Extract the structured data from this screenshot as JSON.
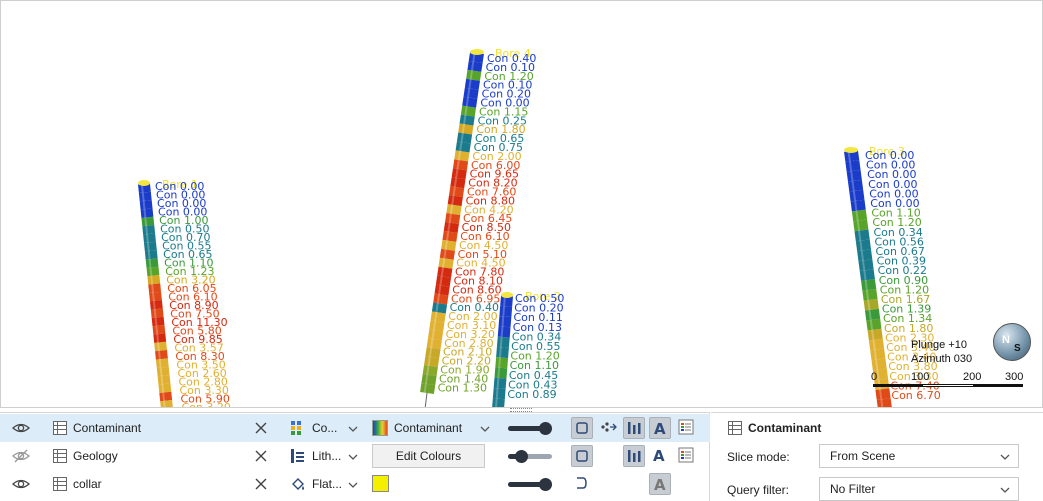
{
  "scene": {
    "holes": [
      {
        "name": "Bore 1",
        "labels": [
          "Con 0.00",
          "Con 0.00",
          "Con 0.00",
          "Con 0.00",
          "Con 1.00",
          "Con 0.50",
          "Con 0.70",
          "Con 0.55",
          "Con 0.65",
          "Con 1.10",
          "Con 1.23",
          "Con 3.20",
          "Con 6.05",
          "Con 6.10",
          "Con 8.90",
          "Con 7.50",
          "Con 11.30",
          "Con 5.80",
          "Con 9.85",
          "Con 3.57",
          "Con 8.30",
          "Con 3.50",
          "Con 2.60",
          "Con 2.80",
          "Con 3.30",
          "Con 5.90",
          "Con 3.20"
        ],
        "colors": [
          "#1a3cc9",
          "#1a3cc9",
          "#1a3cc9",
          "#1a3cc9",
          "#3a9a3a",
          "#1b7a8c",
          "#1b7a8c",
          "#1b7a8c",
          "#1b7a8c",
          "#3a9a3a",
          "#58a42a",
          "#d8a820",
          "#e04a18",
          "#e04a18",
          "#d42a10",
          "#e04a18",
          "#d42a10",
          "#e04a18",
          "#d42a10",
          "#e0b030",
          "#e04a18",
          "#e0b030",
          "#e0b030",
          "#e0b030",
          "#e0b030",
          "#e04a18",
          "#e0b030"
        ]
      },
      {
        "name": "Bore 4",
        "labels": [
          "Con 0.40",
          "Con 0.10",
          "Con 1.20",
          "Con 0.10",
          "Con 0.20",
          "Con 0.00",
          "Con 1.15",
          "Con 0.25",
          "Con 1.80",
          "Con 0.65",
          "Con 0.75",
          "Con 2.00",
          "Con 6.00",
          "Con 9.65",
          "Con 8.20",
          "Con 7.60",
          "Con 8.80",
          "Con 4.20",
          "Con 6.45",
          "Con 8.50",
          "Con 6.10",
          "Con 4.50",
          "Con 5.10",
          "Con 4.50",
          "Con 7.80",
          "Con 8.10",
          "Con 8.60",
          "Con 6.95",
          "Con 0.40",
          "Con 2.00",
          "Con 3.10",
          "Con 3.20",
          "Con 2.80",
          "Con 2.10",
          "Con 2.20",
          "Con 1.90",
          "Con 1.40",
          "Con 1.30"
        ],
        "colors": [
          "#1a3cc9",
          "#1a3cc9",
          "#58a42a",
          "#1a3cc9",
          "#1a3cc9",
          "#1a3cc9",
          "#58a42a",
          "#1b7a8c",
          "#d8a820",
          "#1b7a8c",
          "#1b7a8c",
          "#e0b030",
          "#e04a18",
          "#d42a10",
          "#d42a10",
          "#e04a18",
          "#d42a10",
          "#e0b030",
          "#e04a18",
          "#d42a10",
          "#e04a18",
          "#e0b030",
          "#e04a18",
          "#e0b030",
          "#d42a10",
          "#d42a10",
          "#d42a10",
          "#e04a18",
          "#1b7a8c",
          "#e0b030",
          "#e0b030",
          "#e0b030",
          "#e0b030",
          "#c8a828",
          "#c8a828",
          "#8aa82a",
          "#6ea22a",
          "#6ea22a"
        ]
      },
      {
        "name": "Bore 2",
        "labels": [
          "Con 0.50",
          "Con 0.20",
          "Con 0.11",
          "Con 0.13",
          "Con 0.34",
          "Con 0.55",
          "Con 1.20",
          "Con 1.10",
          "Con 0.45",
          "Con 0.43",
          "Con 0.89"
        ],
        "colors": [
          "#1a3cc9",
          "#1a3cc9",
          "#1a3cc9",
          "#1a3cc9",
          "#1b7a8c",
          "#1b7a8c",
          "#58a42a",
          "#3a9a3a",
          "#1b7a8c",
          "#1b7a8c",
          "#1b7a8c"
        ]
      },
      {
        "name": "Bore 3",
        "labels": [
          "Con 0.00",
          "Con 0.00",
          "Con 0.00",
          "Con 0.00",
          "Con 0.00",
          "Con 0.00",
          "Con 1.10",
          "Con 1.20",
          "Con 0.34",
          "Con 0.56",
          "Con 0.67",
          "Con 0.39",
          "Con 0.22",
          "Con 0.90",
          "Con 1.20",
          "Con 1.67",
          "Con 1.39",
          "Con 1.34",
          "Con 1.80",
          "Con 2.30",
          "Con 3.40",
          "Con 3.40",
          "Con 3.80",
          "Con 3.30",
          "Con 7.40",
          "Con 6.70"
        ],
        "colors": [
          "#1a3cc9",
          "#1a3cc9",
          "#1a3cc9",
          "#1a3cc9",
          "#1a3cc9",
          "#1a3cc9",
          "#58a42a",
          "#58a42a",
          "#1b7a8c",
          "#1b7a8c",
          "#1b7a8c",
          "#1b7a8c",
          "#1b7a8c",
          "#3a9a3a",
          "#58a42a",
          "#a8a828",
          "#3a9a3a",
          "#58a42a",
          "#c8a828",
          "#e0b030",
          "#e0b030",
          "#e0b030",
          "#e0b030",
          "#e0b030",
          "#e04a18",
          "#e04a18"
        ]
      }
    ],
    "overlay": {
      "plunge": "Plunge +10",
      "azimuth": "Azimuth 030",
      "scale_ticks": [
        "0",
        "100",
        "200",
        "300"
      ]
    }
  },
  "layers": {
    "rows": [
      {
        "name": "Contaminant",
        "column": "Co...",
        "colour": "Contaminant",
        "opacity": 0.85,
        "selected": true
      },
      {
        "name": "Geology",
        "column": "Lith...",
        "colour": "Edit Colours",
        "opacity": 0.3,
        "selected": false
      },
      {
        "name": "collar",
        "column": "Flat...",
        "colour": "#f5f000",
        "opacity": 0.85,
        "selected": false
      }
    ]
  },
  "properties": {
    "title": "Contaminant",
    "slice_mode_label": "Slice mode:",
    "slice_mode_value": "From Scene",
    "query_filter_label": "Query filter:",
    "query_filter_value": "No Filter"
  },
  "colors": {
    "selected_row": "#dcecf8",
    "yellow_swatch": "#f5f000",
    "low": "#1a3cc9",
    "mid": "#1b7a8c",
    "high": "#e04a18"
  }
}
